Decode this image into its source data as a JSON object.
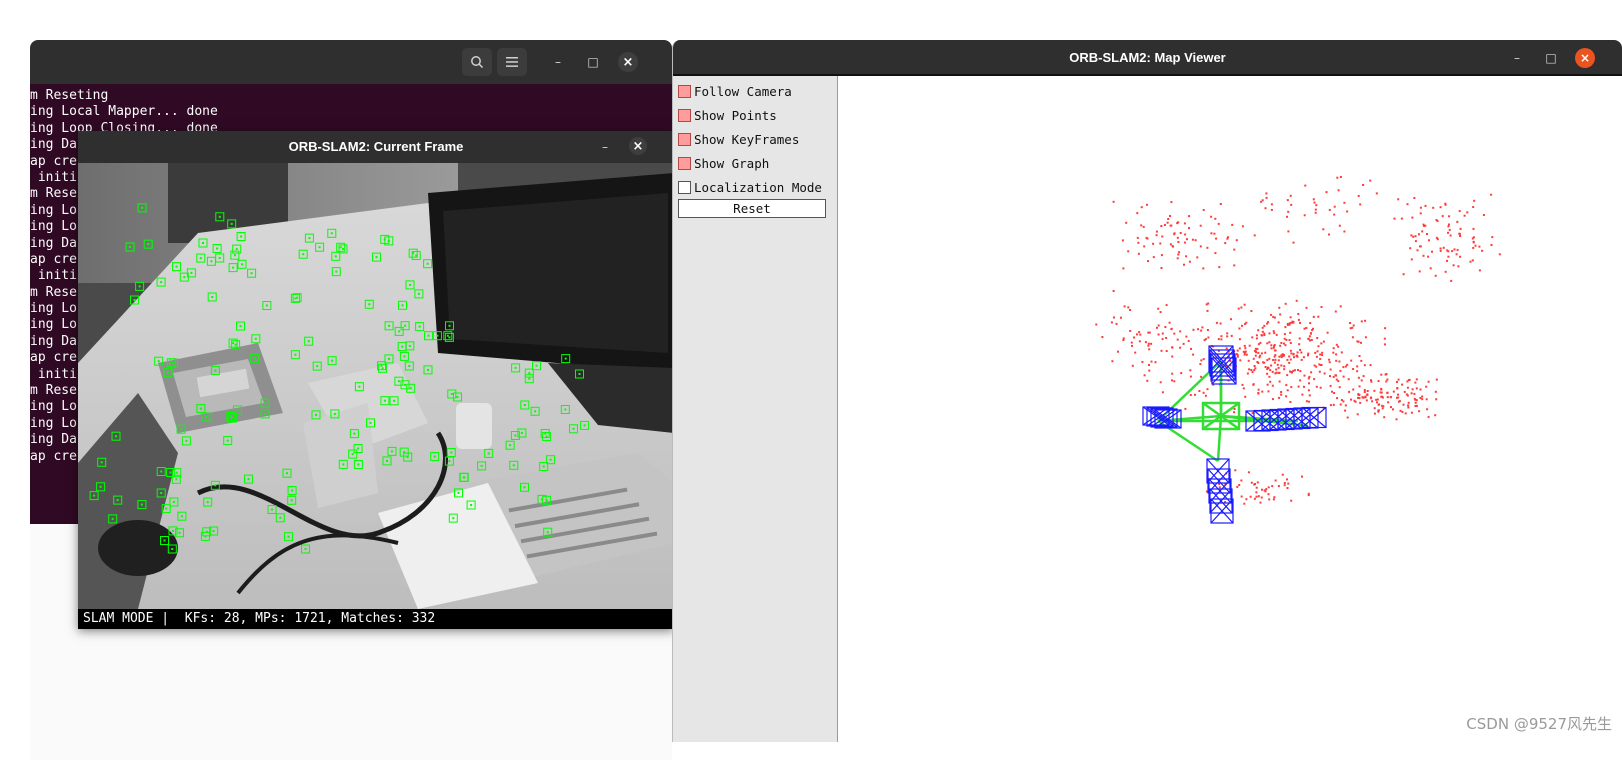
{
  "terminal": {
    "lines": [
      "m Reseting",
      "ing Local Mapper... done",
      "ing Loop Closing... done",
      "ing Da",
      "ap cre",
      " initi",
      "m Rese",
      "ing Lo",
      "ing Lo",
      "ing Da",
      "ap cre",
      " initi",
      "m Rese",
      "ing Lo",
      "ing Lo",
      "ing Da",
      "ap cre",
      " initi",
      "m Rese",
      "ing Lo",
      "ing Lo",
      "ing Da",
      "ap cre"
    ],
    "colors": {
      "background": "#300a24",
      "text": "#ffffff"
    },
    "icons": {
      "search": "search-icon",
      "menu": "hamburger-menu-icon",
      "minimize": "minimize-icon",
      "maximize": "maximize-icon",
      "close": "close-icon"
    }
  },
  "current_frame": {
    "title": "ORB-SLAM2: Current Frame",
    "status": "SLAM MODE |  KFs: 28, MPs: 1721, Matches: 332",
    "feature_color": "#00ff00",
    "icons": {
      "minimize": "minimize-icon",
      "close": "close-icon"
    }
  },
  "map_viewer": {
    "title": "ORB-SLAM2: Map Viewer",
    "controls": [
      {
        "label": "Follow Camera",
        "checked": true
      },
      {
        "label": "Show Points",
        "checked": true
      },
      {
        "label": "Show KeyFrames",
        "checked": true
      },
      {
        "label": "Show Graph",
        "checked": true
      },
      {
        "label": "Localization Mode",
        "checked": false
      }
    ],
    "reset_label": "Reset",
    "colors": {
      "map_points": "#ff3b3b",
      "keyframes": "#1a1aff",
      "graph": "#33dd33",
      "close_button": "#e95420"
    },
    "icons": {
      "minimize": "minimize-icon",
      "maximize": "maximize-icon",
      "close": "close-icon"
    }
  },
  "watermark": "CSDN @9527风先生"
}
